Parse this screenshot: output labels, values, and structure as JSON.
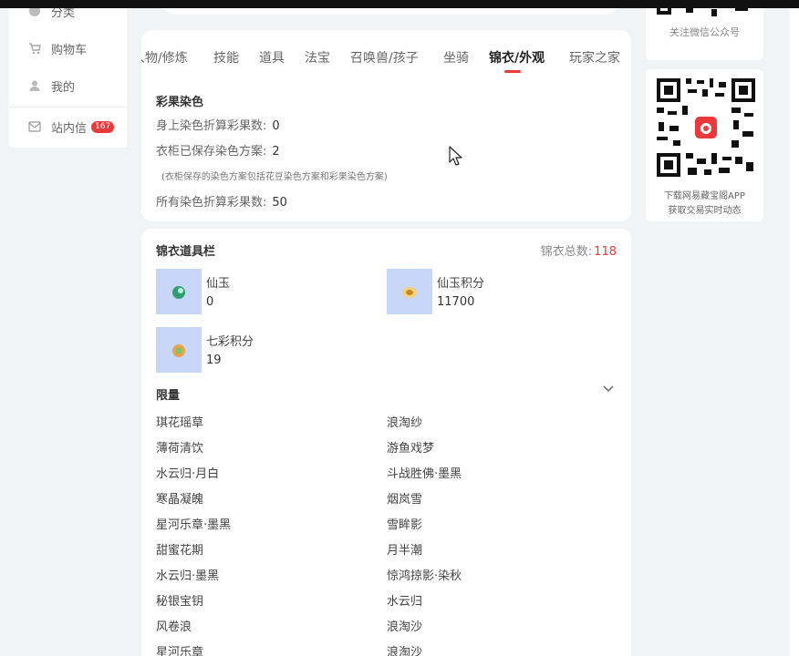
{
  "sidebar": {
    "items": [
      {
        "label": "分类",
        "icon": "category-icon"
      },
      {
        "label": "购物车",
        "icon": "cart-icon"
      },
      {
        "label": "我的",
        "icon": "user-icon"
      },
      {
        "label": "站内信",
        "icon": "mail-icon",
        "badge": "167"
      }
    ]
  },
  "tabs": {
    "items": [
      "人物/修炼",
      "技能",
      "道具",
      "法宝",
      "召唤兽/孩子",
      "坐骑",
      "锦衣/外观",
      "玩家之家"
    ],
    "active": "锦衣/外观"
  },
  "dye": {
    "heading": "彩果染色",
    "rows": [
      {
        "label": "身上染色折算彩果数:",
        "value": "0"
      },
      {
        "label": "衣柜已保存染色方案:",
        "value": "2"
      },
      {
        "label": "所有染色折算彩果数:",
        "value": "50"
      }
    ],
    "note": "(衣柜保存的染色方案包括花豆染色方案和彩果染色方案)"
  },
  "wardrobe": {
    "title": "锦衣道具栏",
    "total_label": "锦衣总数:",
    "total_value": "118",
    "items": [
      {
        "name": "仙玉",
        "value": "0",
        "icon": "jade-icon"
      },
      {
        "name": "仙玉积分",
        "value": "11700",
        "icon": "jade-points-icon"
      },
      {
        "name": "七彩积分",
        "value": "19",
        "icon": "rainbow-points-icon"
      }
    ],
    "limited_title": "限量",
    "limited_left": [
      "琪花瑶草",
      "薄荷清饮",
      "水云归·月白",
      "寒晶凝魄",
      "星河乐章·墨黑",
      "甜蜜花期",
      "水云归·墨黑",
      "秘银宝钥",
      "风卷浪",
      "星河乐章"
    ],
    "limited_right": [
      "浪淘纱",
      "游鱼戏梦",
      "斗战胜佛·墨黑",
      "烟岚雪",
      "雪眸影",
      "月半潮",
      "惊鸿掠影·染秋",
      "水云归",
      "浪淘沙",
      "浪淘沙"
    ]
  },
  "right": {
    "top_caption": "关注微信公众号",
    "qr_caption_1": "下载网易藏宝阁APP",
    "qr_caption_2": "获取交易实时动态"
  },
  "colors": {
    "accent": "#e9393a",
    "thumb_bg": "#c8d6f7",
    "page_bg": "#f2f3f5"
  }
}
